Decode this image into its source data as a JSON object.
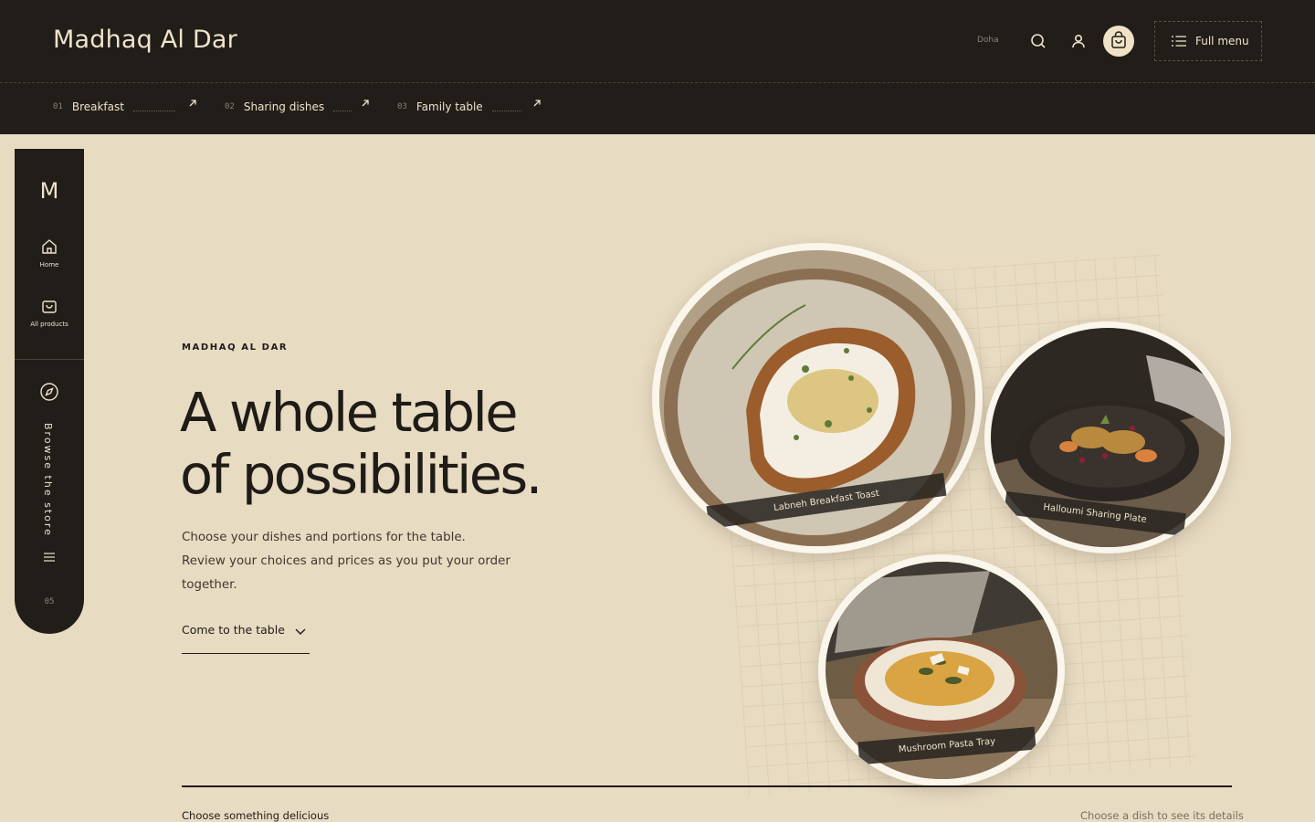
{
  "header": {
    "brand": "Madhaq Al Dar",
    "city": "Doha",
    "full_menu_label": "Full menu",
    "icons": [
      "search-icon",
      "user-icon",
      "cart-icon",
      "menu-list-icon"
    ]
  },
  "categories": [
    {
      "num": "01",
      "label": "Breakfast"
    },
    {
      "num": "02",
      "label": "Sharing dishes"
    },
    {
      "num": "03",
      "label": "Family table"
    }
  ],
  "sidebar": {
    "logo": "M",
    "items": [
      {
        "label": "Home",
        "icon": "home-icon"
      },
      {
        "label": "All products",
        "icon": "bag-icon"
      }
    ],
    "browse_label": "Browse the store",
    "count": "05"
  },
  "hero": {
    "eyebrow": "MADHAQ AL DAR",
    "headline_line1": "A whole table",
    "headline_line2": "of possibilities.",
    "sub_line1": "Choose your dishes and portions for the table.",
    "sub_line2": "Review your choices and prices as you put your order together.",
    "cta_label": "Come to the table"
  },
  "dishes": [
    {
      "name": "Labneh Breakfast Toast"
    },
    {
      "name": "Halloumi Sharing Plate"
    },
    {
      "name": "Mushroom Pasta Tray"
    }
  ],
  "footer": {
    "left": "Choose something delicious",
    "right": "Choose a dish to see its details"
  },
  "colors": {
    "dark": "#211d19",
    "cream": "#e7dbc2",
    "light_text": "#efe3cb",
    "muted": "#8d8273"
  }
}
